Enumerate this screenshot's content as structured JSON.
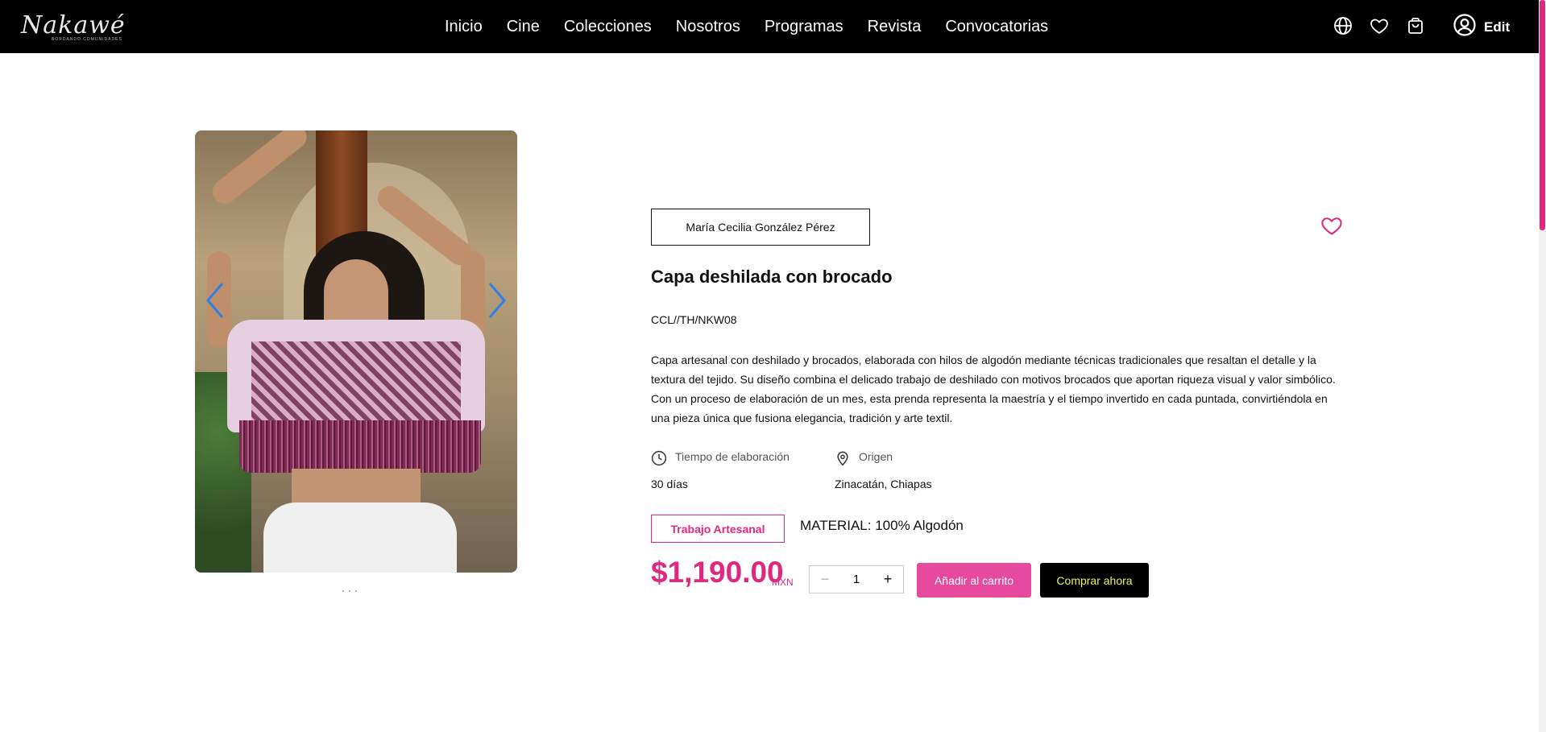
{
  "brand": {
    "name": "Nakawé",
    "tagline": "BORDANDO COMUNIDADES"
  },
  "nav": {
    "items": [
      {
        "label": "Inicio"
      },
      {
        "label": "Cine"
      },
      {
        "label": "Colecciones"
      },
      {
        "label": "Nosotros"
      },
      {
        "label": "Programas"
      },
      {
        "label": "Revista"
      },
      {
        "label": "Convocatorias"
      }
    ]
  },
  "header_icons": [
    "globe-icon",
    "heart-icon",
    "shopping-bag-icon",
    "user-icon"
  ],
  "user": {
    "edit_label": "Edit"
  },
  "gallery": {
    "image_alt": "Mujer con capa deshilada con brocado",
    "dot_count": 3
  },
  "product": {
    "artist": "María Cecilia González Pérez",
    "title": "Capa deshilada con brocado",
    "sku": "CCL//TH/NKW08",
    "description": "Capa artesanal con deshilado y brocados, elaborada con hilos de algodón mediante técnicas tradicionales que resaltan el detalle y la textura del tejido. Su diseño combina el delicado trabajo de deshilado con motivos brocados que aportan riqueza visual y valor simbólico. Con un proceso de elaboración de un mes, esta prenda representa la maestría y el tiempo invertido en cada puntada, convirtiéndola en una pieza única que fusiona elegancia, tradición y arte textil.",
    "time_label": "Tiempo de elaboración",
    "time_value": "30 días",
    "origin_label": "Origen",
    "origin_value": "Zinacatán, Chiapas",
    "badge": "Trabajo Artesanal",
    "material": "MATERIAL:  100% Algodón",
    "price": "$1,190.00",
    "currency": "MXN",
    "quantity": "1",
    "minus": "−",
    "plus": "+",
    "add_to_cart": "Añadir al carrito",
    "buy_now": "Comprar ahora"
  },
  "colors": {
    "accent": "#e0287f",
    "cart_button": "#e7499e",
    "buy_text": "#e7f55b",
    "header_bg": "#000000"
  }
}
